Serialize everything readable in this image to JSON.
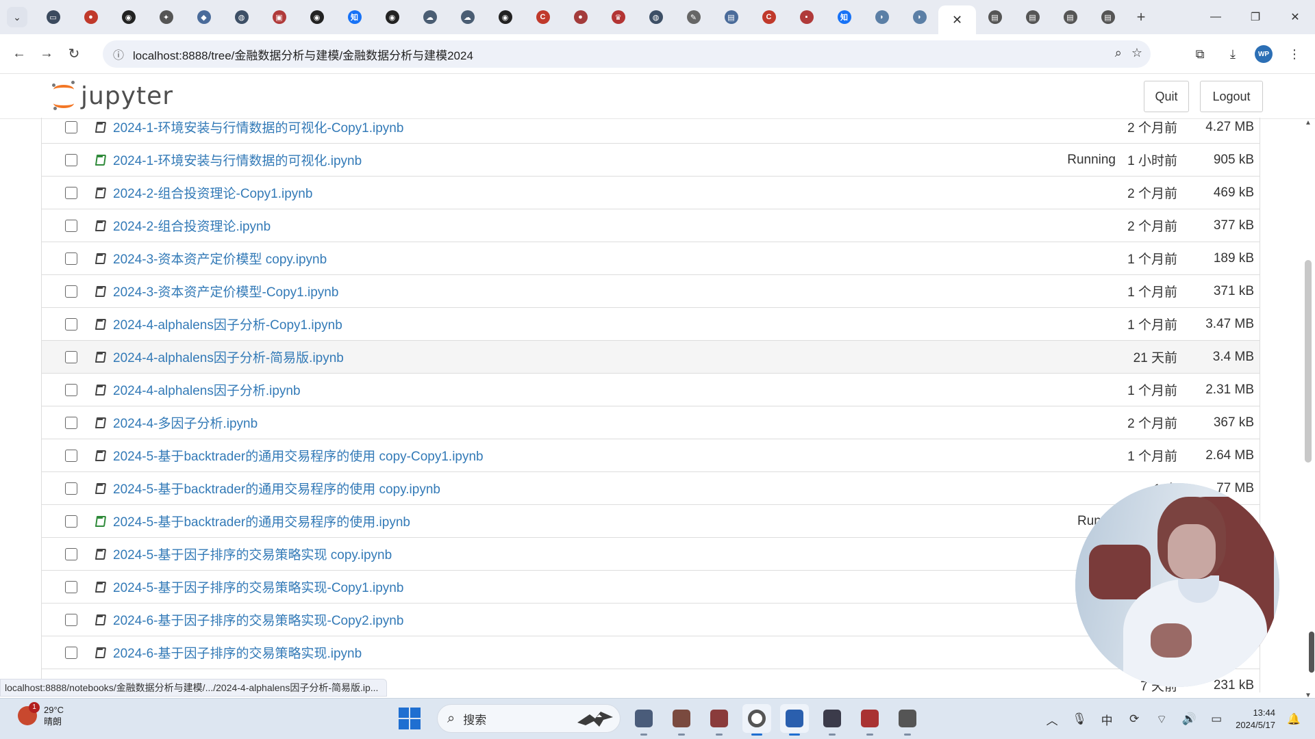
{
  "browser": {
    "tab_favicons": [
      {
        "icon": "bilibili-icon",
        "color": "#3b4a5e",
        "glyph": "▭"
      },
      {
        "icon": "red-circle-icon",
        "color": "#c0392b",
        "glyph": "●"
      },
      {
        "icon": "github-icon",
        "color": "#222222",
        "glyph": "◉"
      },
      {
        "icon": "sparkle-icon",
        "color": "#555555",
        "glyph": "✦"
      },
      {
        "icon": "robot-icon",
        "color": "#4a6b9a",
        "glyph": "◆"
      },
      {
        "icon": "globe-icon",
        "color": "#3d4f66",
        "glyph": "◍"
      },
      {
        "icon": "mail-icon",
        "color": "#b03a3a",
        "glyph": "▣"
      },
      {
        "icon": "github-icon",
        "color": "#222222",
        "glyph": "◉"
      },
      {
        "icon": "zhihu-icon",
        "color": "#1772f6",
        "glyph": "知"
      },
      {
        "icon": "github-icon",
        "color": "#222222",
        "glyph": "◉"
      },
      {
        "icon": "cloud-icon",
        "color": "#4a5d73",
        "glyph": "☁"
      },
      {
        "icon": "cloud-icon",
        "color": "#4a5d73",
        "glyph": "☁"
      },
      {
        "icon": "github-icon",
        "color": "#222222",
        "glyph": "◉"
      },
      {
        "icon": "c-red-icon",
        "color": "#c0392b",
        "glyph": "C"
      },
      {
        "icon": "alien-icon",
        "color": "#a33b3b",
        "glyph": "●"
      },
      {
        "icon": "crown-icon",
        "color": "#b33434",
        "glyph": "♛"
      },
      {
        "icon": "globe-icon",
        "color": "#3d4f66",
        "glyph": "◍"
      },
      {
        "icon": "feather-icon",
        "color": "#666666",
        "glyph": "✎"
      },
      {
        "icon": "book-icon",
        "color": "#4a6b9a",
        "glyph": "▤"
      },
      {
        "icon": "c-red-icon",
        "color": "#c0392b",
        "glyph": "C"
      },
      {
        "icon": "medium-icon",
        "color": "#b03a3a",
        "glyph": "▪"
      },
      {
        "icon": "zhihu-icon",
        "color": "#1772f6",
        "glyph": "知"
      },
      {
        "icon": "bird-icon",
        "color": "#5b7fa6",
        "glyph": "◗"
      },
      {
        "icon": "bird-icon",
        "color": "#5b7fa6",
        "glyph": "◗"
      }
    ],
    "active_tab_close": "✕",
    "trailing_tab_favicons": [
      {
        "icon": "notebook-icon",
        "color": "#555555",
        "glyph": "▤"
      },
      {
        "icon": "notebook-icon",
        "color": "#555555",
        "glyph": "▤"
      },
      {
        "icon": "notebook-icon",
        "color": "#555555",
        "glyph": "▤"
      },
      {
        "icon": "notebook-icon",
        "color": "#555555",
        "glyph": "▤"
      }
    ],
    "url": "localhost:8888/tree/金融数据分析与建模/金融数据分析与建模2024"
  },
  "jupyter": {
    "logo_text": "jupyter",
    "quit_label": "Quit",
    "logout_label": "Logout",
    "accent": "#f37726",
    "link_color": "#337ab7"
  },
  "files": [
    {
      "name": "2024-1-环境安装与行情数据的可视化-Copy1.ipynb",
      "status": "",
      "modified": "2 个月前",
      "size": "4.27 MB"
    },
    {
      "name": "2024-1-环境安装与行情数据的可视化.ipynb",
      "status": "Running",
      "modified": "1 小时前",
      "size": "905 kB"
    },
    {
      "name": "2024-2-组合投资理论-Copy1.ipynb",
      "status": "",
      "modified": "2 个月前",
      "size": "469 kB"
    },
    {
      "name": "2024-2-组合投资理论.ipynb",
      "status": "",
      "modified": "2 个月前",
      "size": "377 kB"
    },
    {
      "name": "2024-3-资本资产定价模型 copy.ipynb",
      "status": "",
      "modified": "1 个月前",
      "size": "189 kB"
    },
    {
      "name": "2024-3-资本资产定价模型-Copy1.ipynb",
      "status": "",
      "modified": "1 个月前",
      "size": "371 kB"
    },
    {
      "name": "2024-4-alphalens因子分析-Copy1.ipynb",
      "status": "",
      "modified": "1 个月前",
      "size": "3.47 MB"
    },
    {
      "name": "2024-4-alphalens因子分析-简易版.ipynb",
      "status": "",
      "modified": "21 天前",
      "size": "3.4 MB"
    },
    {
      "name": "2024-4-alphalens因子分析.ipynb",
      "status": "",
      "modified": "1 个月前",
      "size": "2.31 MB"
    },
    {
      "name": "2024-4-多因子分析.ipynb",
      "status": "",
      "modified": "2 个月前",
      "size": "367 kB"
    },
    {
      "name": "2024-5-基于backtrader的通用交易程序的使用 copy-Copy1.ipynb",
      "status": "",
      "modified": "1 个月前",
      "size": "2.64 MB"
    },
    {
      "name": "2024-5-基于backtrader的通用交易程序的使用 copy.ipynb",
      "status": "",
      "modified": "1 个",
      "size": "77 MB"
    },
    {
      "name": "2024-5-基于backtrader的通用交易程序的使用.ipynb",
      "status": "Runnir",
      "modified": "",
      "size": ""
    },
    {
      "name": "2024-5-基于因子排序的交易策略实现 copy.ipynb",
      "status": "",
      "modified": "",
      "size": ""
    },
    {
      "name": "2024-5-基于因子排序的交易策略实现-Copy1.ipynb",
      "status": "",
      "modified": "",
      "size": ""
    },
    {
      "name": "2024-6-基于因子排序的交易策略实现-Copy2.ipynb",
      "status": "",
      "modified": "",
      "size": ""
    },
    {
      "name": "2024-6-基于因子排序的交易策略实现.ipynb",
      "status": "",
      "modified": "",
      "size": ""
    },
    {
      "name": "",
      "status": "",
      "modified": "7 天前",
      "size": "231 kB"
    }
  ],
  "status_bubble": "localhost:8888/notebooks/金融数据分析与建模/.../2024-4-alphalens因子分析-简易版.ip...",
  "taskbar": {
    "weather_temp": "29°C",
    "weather_desc": "晴朗",
    "weather_badge": "1",
    "search_placeholder": "搜索",
    "time": "13:44",
    "date": "2024/5/17",
    "apps": [
      {
        "icon": "file-manager-icon",
        "color": "#4a5c7a"
      },
      {
        "icon": "folder-icon",
        "color": "#7a4a3f"
      },
      {
        "icon": "image-viewer-icon",
        "color": "#8a3b3b"
      },
      {
        "icon": "chrome-icon",
        "color": "#444444"
      },
      {
        "icon": "code-editor-icon",
        "color": "#2a5fae"
      },
      {
        "icon": "terminal-icon",
        "color": "#3b3b4a"
      },
      {
        "icon": "wps-icon",
        "color": "#a93232"
      },
      {
        "icon": "record-icon",
        "color": "#555555"
      }
    ],
    "tray_icons": [
      "chevron-up-icon",
      "microphone-icon",
      "ime-icon",
      "sync-icon",
      "wifi-icon",
      "volume-icon",
      "battery-icon"
    ],
    "tray_glyphs": [
      "︿",
      "🎙",
      "中",
      "⟳",
      "⌔",
      "🔊",
      "▭"
    ]
  }
}
